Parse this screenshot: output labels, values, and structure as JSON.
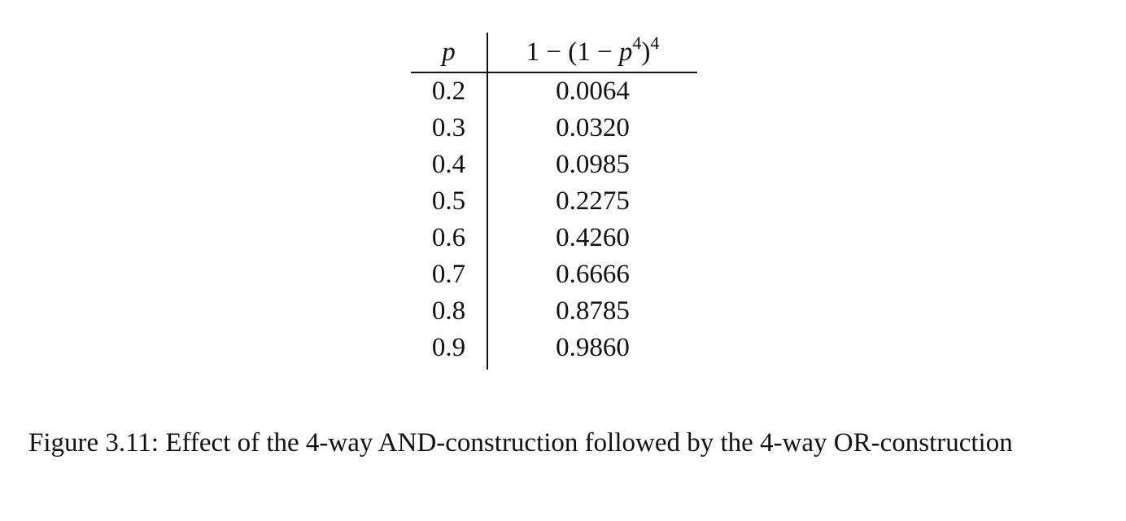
{
  "table": {
    "header": {
      "col_p": "p",
      "col_formula_prefix": "1 − (1 − ",
      "col_formula_var": "p",
      "col_formula_inner_exp": "4",
      "col_formula_close": ")",
      "col_formula_outer_exp": "4"
    },
    "rows": [
      {
        "p": "0.2",
        "value": "0.0064"
      },
      {
        "p": "0.3",
        "value": "0.0320"
      },
      {
        "p": "0.4",
        "value": "0.0985"
      },
      {
        "p": "0.5",
        "value": "0.2275"
      },
      {
        "p": "0.6",
        "value": "0.4260"
      },
      {
        "p": "0.7",
        "value": "0.6666"
      },
      {
        "p": "0.8",
        "value": "0.8785"
      },
      {
        "p": "0.9",
        "value": "0.9860"
      }
    ]
  },
  "caption": {
    "text": "Figure 3.11: Effect of the 4-way AND-construction followed by the 4-way OR-construction"
  }
}
